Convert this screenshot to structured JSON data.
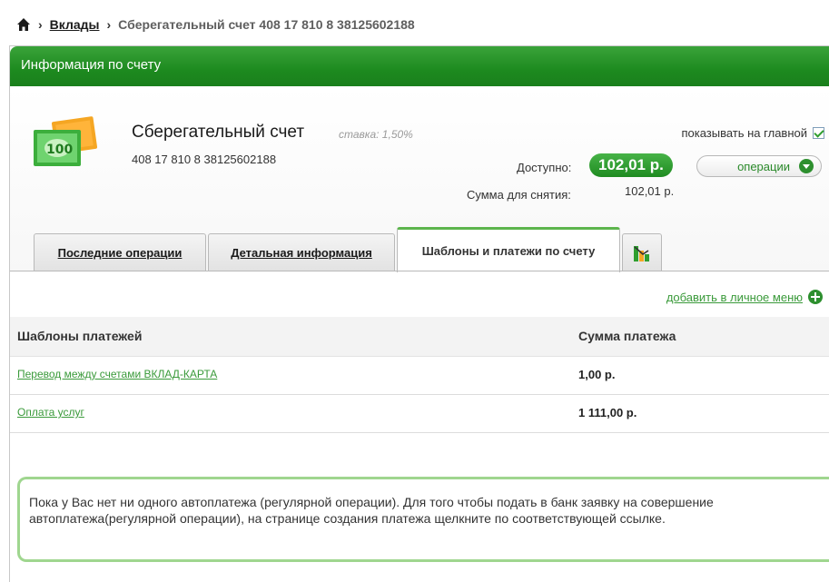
{
  "breadcrumb": {
    "link": "Вклады",
    "current": "Сберегательный счет 408 17 810 8 38125602188"
  },
  "panel": {
    "title": "Информация по счету"
  },
  "account": {
    "name": "Сберегательный счет",
    "rate": "ставка: 1,50%",
    "number": "408 17 810 8 38125602188",
    "show_on_main_label": "показывать на главной",
    "show_on_main_checked": true,
    "available_label": "Доступно:",
    "available_value": "102,01 р.",
    "operations_button": "операции",
    "withdraw_label": "Сумма для снятия:",
    "withdraw_value": "102,01 р.",
    "accent_color": "#1f8b21"
  },
  "tabs": [
    {
      "label": "Последние операции",
      "active": false
    },
    {
      "label": "Детальная информация",
      "active": false
    },
    {
      "label": "Шаблоны и платежи по счету",
      "active": true
    },
    {
      "label": "",
      "icon": "chart-icon",
      "active": false
    }
  ],
  "templates": {
    "add_to_menu": "добавить в личное меню",
    "headers": {
      "name": "Шаблоны платежей",
      "amount": "Сумма платежа"
    },
    "rows": [
      {
        "name": "Перевод между счетами ВКЛАД-КАРТА",
        "amount": "1,00 р."
      },
      {
        "name": "Оплата услуг",
        "amount": "1 111,00 р."
      }
    ]
  },
  "autopay_info": "Пока у Вас нет ни одного автоплатежа (регулярной операции). Для того чтобы подать в банк заявку на совершение автоплатежа(регулярной операции), на странице создания платежа щелкните по соответствующей ссылке."
}
